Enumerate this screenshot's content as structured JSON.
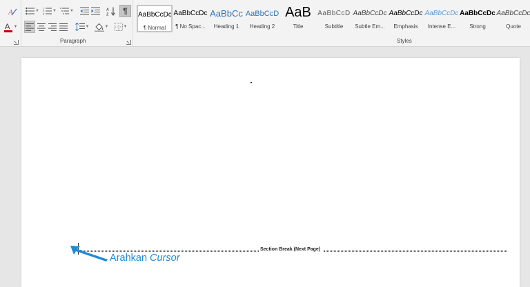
{
  "ribbon": {
    "groups": {
      "paragraph_label": "Paragraph",
      "styles_label": "Styles"
    },
    "paragraph_toolbar": {
      "row1": [
        "bullets-icon",
        "numbering-icon",
        "multilevel-list-icon",
        "decrease-indent-icon",
        "increase-indent-icon",
        "sort-icon",
        "show-formatting-marks-icon"
      ],
      "row2": [
        "align-left-icon",
        "align-center-icon",
        "align-right-icon",
        "justify-icon",
        "line-spacing-icon",
        "shading-icon",
        "borders-icon"
      ],
      "show_formatting_marks_pressed": true,
      "align_left_selected": true
    },
    "font_toolbar_fragment": [
      "text-effects-icon",
      "font-color-icon"
    ],
    "font_color": "#c00000",
    "styles": [
      {
        "sample": "AaBbCcDc",
        "name": "¶ Normal",
        "active": true
      },
      {
        "sample": "AaBbCcDc",
        "name": "¶ No Spac..."
      },
      {
        "sample": "AaBbCc",
        "name": "Heading 1",
        "color": "#2e74b5"
      },
      {
        "sample": "AaBbCcD",
        "name": "Heading 2",
        "color": "#2e74b5"
      },
      {
        "sample": "AaB",
        "name": "Title"
      },
      {
        "sample": "AaBbCcD",
        "name": "Subtitle",
        "color": "#595959"
      },
      {
        "sample": "AaBbCcDc",
        "name": "Subtle Em...",
        "color": "#404040"
      },
      {
        "sample": "AaBbCcDc",
        "name": "Emphasis"
      },
      {
        "sample": "AaBbCcDc",
        "name": "Intense E...",
        "color": "#5b9bd5"
      },
      {
        "sample": "AaBbCcDc",
        "name": "Strong"
      },
      {
        "sample": "AaBbCcDc",
        "name": "Quote",
        "color": "#404040"
      }
    ]
  },
  "document": {
    "section_break_label": "Section Break (Next Page)"
  },
  "annotation": {
    "text": "Arahkan",
    "emphasis": "Cursor",
    "color": "#1f8bd8"
  }
}
